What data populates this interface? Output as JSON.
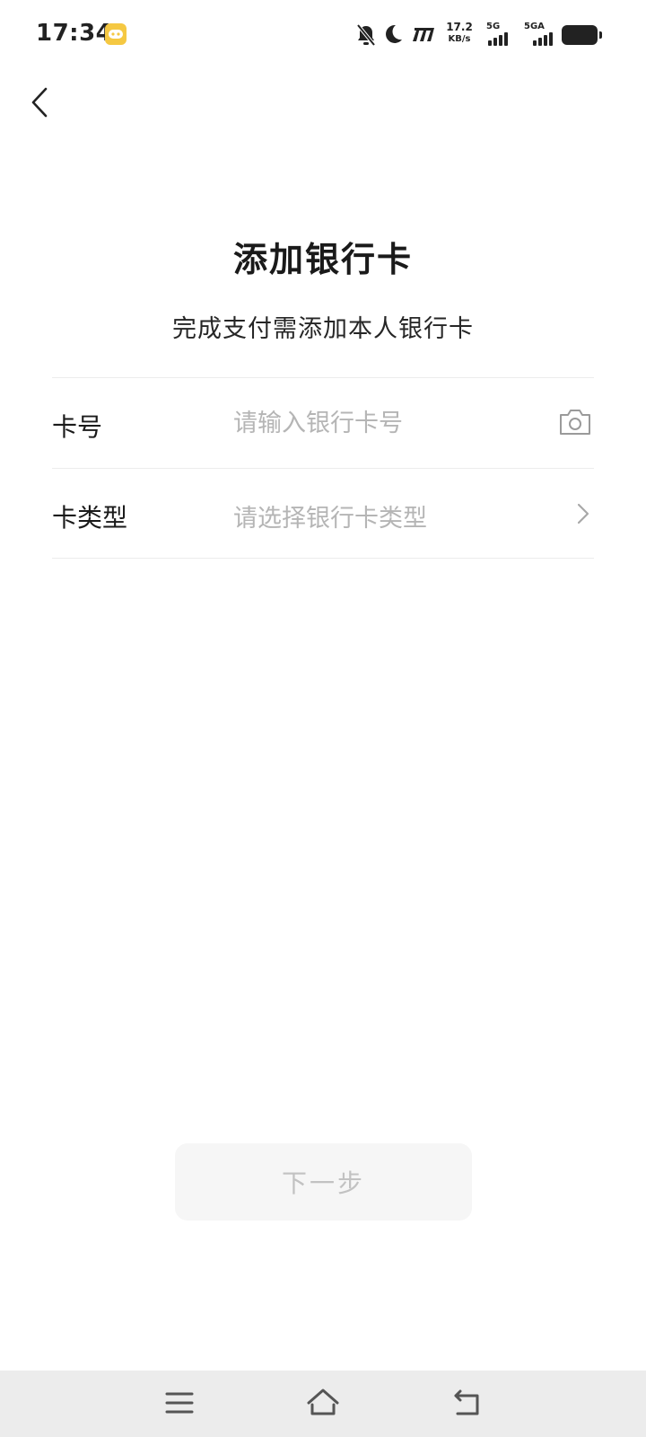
{
  "status_bar": {
    "time": "17:34",
    "speed_value": "17.2",
    "speed_unit": "KB/s",
    "sim1_label": "5G",
    "sim2_label": "5GA",
    "icons": [
      "game-app-icon",
      "bell-off-icon",
      "moon-icon",
      "m-brand-icon",
      "signal-icon",
      "signal-icon",
      "battery-icon"
    ]
  },
  "header": {
    "back_icon": "chevron-left-icon"
  },
  "page": {
    "title": "添加银行卡",
    "subtitle": "完成支付需添加本人银行卡"
  },
  "form": {
    "card_number": {
      "label": "卡号",
      "placeholder": "请输入银行卡号",
      "value": "",
      "icon": "camera-icon"
    },
    "card_type": {
      "label": "卡类型",
      "placeholder": "请选择银行卡类型",
      "icon": "chevron-right-icon"
    }
  },
  "actions": {
    "next_label": "下一步",
    "next_enabled": false
  },
  "nav_bar": {
    "icons": [
      "menu-icon",
      "home-icon",
      "back-nav-icon"
    ]
  },
  "colors": {
    "placeholder": "#b5b5b5",
    "divider": "#ececec",
    "button_disabled_bg": "#f6f6f6",
    "button_disabled_text": "#c2c2c2",
    "app_icon": "#f5c842",
    "nav_bar_bg": "#ececec"
  }
}
